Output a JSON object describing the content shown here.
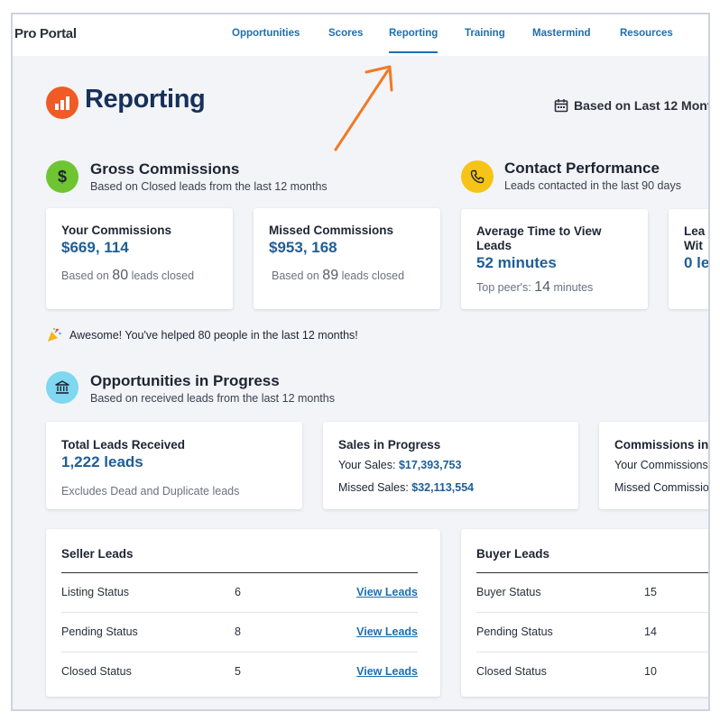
{
  "nav": {
    "brand": "Pro Portal",
    "items": [
      {
        "label": "Opportunities",
        "active": false
      },
      {
        "label": "Scores",
        "active": false
      },
      {
        "label": "Reporting",
        "active": true
      },
      {
        "label": "Training",
        "active": false
      },
      {
        "label": "Mastermind",
        "active": false
      },
      {
        "label": "Resources",
        "active": false
      }
    ]
  },
  "header": {
    "title": "Reporting",
    "period": "Based on Last 12 Mont",
    "icon": "bar-chart-icon",
    "accent": "#f05a24"
  },
  "gross": {
    "title": "Gross Commissions",
    "subtitle": "Based on Closed leads from the last 12 months",
    "icon": "dollar-icon",
    "icon_color": "#6ec531",
    "cards": [
      {
        "title": "Your Commissions",
        "value": "$669, 114",
        "note_pre": "Based on ",
        "note_num": "80",
        "note_post": " leads closed"
      },
      {
        "title": "Missed Commissions",
        "value": "$953, 168",
        "note_pre": "Based on ",
        "note_num": "89",
        "note_post": " leads closed"
      }
    ]
  },
  "contact": {
    "title": "Contact Performance",
    "subtitle": "Leads contacted in the last 90 days",
    "icon": "phone-icon",
    "icon_color": "#f6c416",
    "cards": [
      {
        "title_line1": "Average Time to View",
        "title_line2": "Leads",
        "value": "52 minutes",
        "note_pre": "Top peer's: ",
        "note_num": "14",
        "note_post": " minutes"
      },
      {
        "title_line1": "Lea",
        "title_line2": "Wit",
        "value": "0 le"
      }
    ]
  },
  "celebrate": {
    "icon": "party-popper-icon",
    "text": "Awesome! You've helped 80 people in the last 12 months!"
  },
  "opportunities": {
    "title": "Opportunities in Progress",
    "subtitle": "Based on received leads from the last 12 months",
    "icon": "bank-icon",
    "icon_color": "#7fd7f0",
    "total": {
      "title": "Total Leads Received",
      "value": "1,222 leads",
      "note": "Excludes Dead and Duplicate leads"
    },
    "sales": {
      "title": "Sales in Progress",
      "your_label": "Your Sales: ",
      "your_value": "$17,393,753",
      "missed_label": "Missed Sales: ",
      "missed_value": "$32,113,554"
    },
    "commissions": {
      "title": "Commissions in",
      "your_label": "Your Commissions",
      "missed_label": "Missed Commissio"
    }
  },
  "seller": {
    "title": "Seller Leads",
    "rows": [
      {
        "label": "Listing Status",
        "count": "6",
        "link": "View Leads"
      },
      {
        "label": "Pending Status",
        "count": "8",
        "link": "View Leads"
      },
      {
        "label": "Closed Status",
        "count": "5",
        "link": "View Leads"
      }
    ]
  },
  "buyer": {
    "title": "Buyer Leads",
    "rows": [
      {
        "label": "Buyer Status",
        "count": "15"
      },
      {
        "label": "Pending Status",
        "count": "14"
      },
      {
        "label": "Closed Status",
        "count": "10"
      }
    ]
  }
}
